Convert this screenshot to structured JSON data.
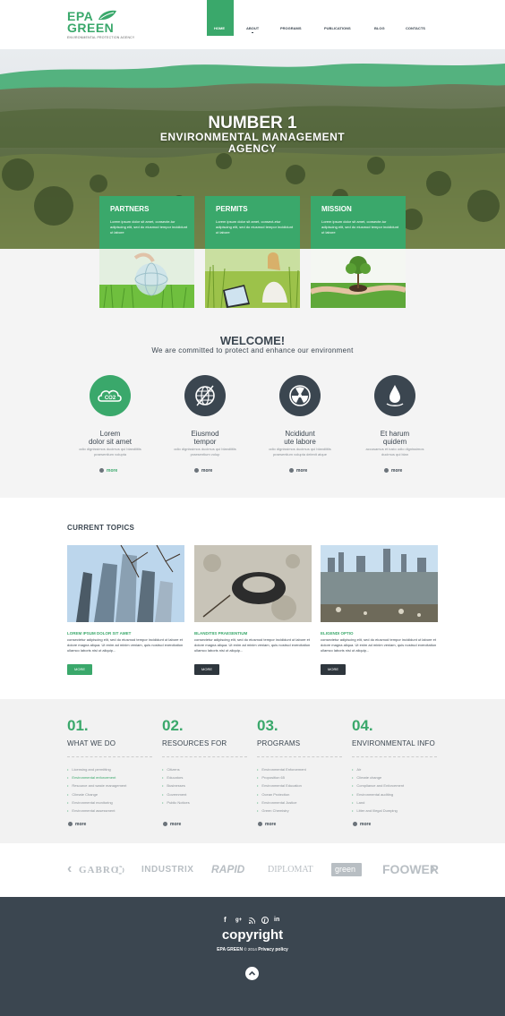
{
  "header": {
    "logo_line1": "EPA",
    "logo_line2": "GREEN",
    "logo_sub": "ENVIRONMENTAL PROTECTION AGENCY",
    "nav": [
      "HOME",
      "ABOUT",
      "PROGRAMS",
      "PUBLICATIONS",
      "BLOG",
      "CONTACTS"
    ],
    "active_nav": "HOME"
  },
  "hero": {
    "line1": "NUMBER 1",
    "line2": "ENVIRONMENTAL MANAGEMENT",
    "line3": "AGENCY"
  },
  "features": [
    {
      "title": "PARTNERS",
      "text": "Lorem ipsum dolor sit amet, consecte-tur adipiscing elit, sed do eiusmod tempor incididunt ut labore"
    },
    {
      "title": "PERMITS",
      "text": "Lorem ipsum dolor sit amet, consect-etur adipiscing elit, sed do eiusmod tempor incididunt ut labore"
    },
    {
      "title": "MISSION",
      "text": "Lorem ipsum dolor sit amet, consecte-tur adipiscing elit, sed do eiusmod tempor incididunt ut labore"
    }
  ],
  "welcome": {
    "title": "WELCOME!",
    "subtitle": "We are committed to protect and enhance our environment",
    "items": [
      {
        "icon": "co2-cloud-icon",
        "title1": "Lorem",
        "title2": "dolor sit amet",
        "text1": "odio dignissimos ducimus qui blandiitiis",
        "text2": "praesentium volupta",
        "more": "more"
      },
      {
        "icon": "globe-icon",
        "title1": "Eiusmod",
        "title2": "tempor",
        "text1": "odio dignissimos ducimus qui blandiitiis",
        "text2": "praesentium volup",
        "more": "more"
      },
      {
        "icon": "radiation-icon",
        "title1": "Ncididunt",
        "title2": "ute labore",
        "text1": "odio dignissimos ducimus qui blandiitiis",
        "text2": "praesentium volupta delenit atque",
        "more": "more"
      },
      {
        "icon": "water-drop-icon",
        "title1": "Et harum",
        "title2": "quidem",
        "text1": "accusamus et iusto odio dignissimos",
        "text2": "ducimus qui blan",
        "more": "more"
      }
    ]
  },
  "topics": {
    "heading": "CURRENT TOPICS",
    "items": [
      {
        "title": "LOREM IPSUM DOLOR SIT AMET",
        "text": "consectetur adipiscing elit, sed do eiusmod tempor incididunt ut labore et dolore magna aliqua. Ut enim ad minim veniam, quis nostrud exercitation ullamco laboris nisi ut aliquip...",
        "button": "MORE"
      },
      {
        "title": "BLANDITIIS PRAESENTIUM",
        "text": "consectetur adipiscing elit, sed do eiusmod tempor incididunt ut labore et dolore magna aliqua. Ut enim ad minim veniam, quis nostrud exercitation ullamco laboris nisi ut aliquip...",
        "button": "MORE"
      },
      {
        "title": "ELIGENDI OPTIO",
        "text": "consectetur adipiscing elit, sed do eiusmod tempor incididunt ut labore et dolore magna aliqua. Ut enim ad minim veniam, quis nostrud exercitation ullamco laboris nisi ut aliquip...",
        "button": "MORE"
      }
    ]
  },
  "categories": [
    {
      "num": "01.",
      "title": "WHAT WE DO",
      "items": [
        "Licensing and permitting",
        "Environmental enforcement",
        "Resource and waste management",
        "Climate Change",
        "Environmental monitoring",
        "Environmental assessment"
      ],
      "highlight": 1,
      "more": "more"
    },
    {
      "num": "02.",
      "title": "RESOURCES FOR",
      "items": [
        "Citizens",
        "Educators",
        "Businesses",
        "Government",
        "Public Notices"
      ],
      "highlight": -1,
      "more": "more"
    },
    {
      "num": "03.",
      "title": "PROGRAMS",
      "items": [
        "Environmental Enforcement",
        "Proposition 65",
        "Environmental Education",
        "Ocean Protection",
        "Environmental Justice",
        "Green Chemistry"
      ],
      "highlight": -1,
      "more": "more"
    },
    {
      "num": "04.",
      "title": "ENVIRONMENTAL INFO",
      "items": [
        "Air",
        "Climate change",
        "Compliance and Enforcement",
        "Environmental auditing",
        "Land",
        "Litter and Illegal Dumping"
      ],
      "highlight": -1,
      "more": "more"
    }
  ],
  "partners": {
    "logos": [
      "GABRO",
      "INDUSTRIX",
      "RAPID",
      "DIPLOMAT",
      "green",
      "FOOWER"
    ],
    "prev": "‹",
    "next": "›"
  },
  "footer": {
    "social": [
      "f",
      "g+",
      "rss",
      "p",
      "in"
    ],
    "copyright": "copyright",
    "brand": "EPA GREEN",
    "year": "© 2014",
    "privacy": "Privacy policy"
  },
  "colors": {
    "accent": "#3aa86b",
    "dark": "#3b4650",
    "light_bg": "#f4f4f4"
  }
}
